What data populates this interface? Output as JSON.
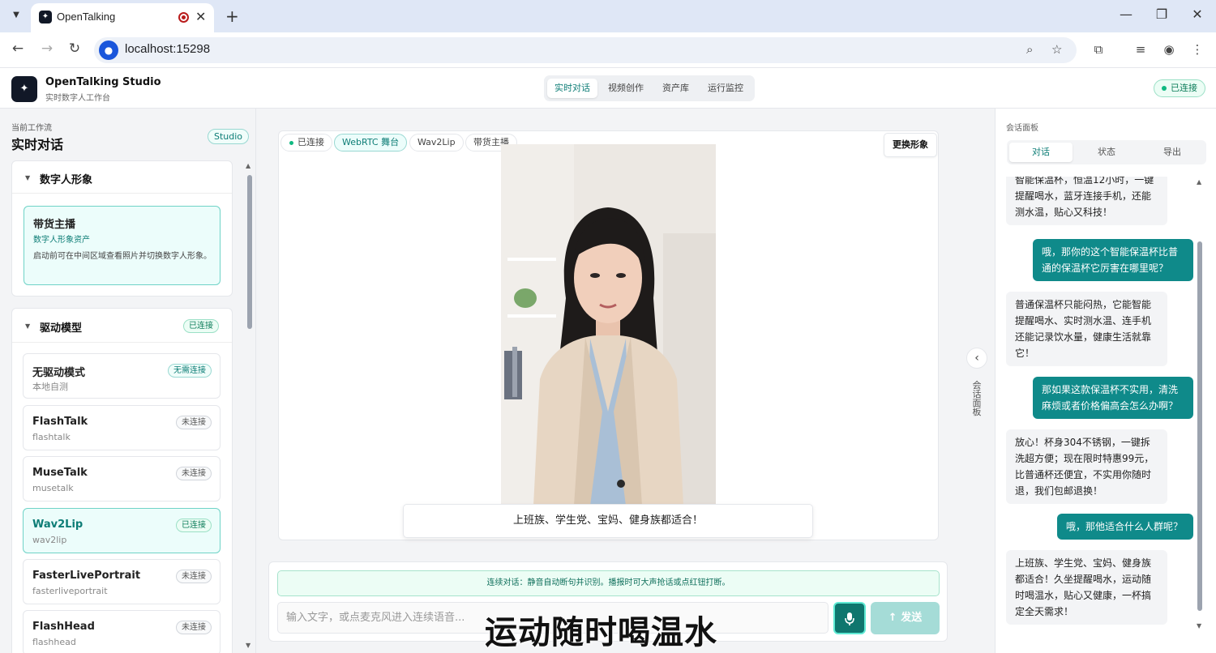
{
  "browser": {
    "tab_title": "OpenTalking",
    "url": "localhost:15298"
  },
  "app": {
    "brand": "OpenTalking Studio",
    "subtitle": "实时数字人工作台",
    "nav": [
      "实时对话",
      "视频创作",
      "资产库",
      "运行监控"
    ],
    "active_nav": "实时对话",
    "status": "已连接"
  },
  "left": {
    "workflow_label": "当前工作流",
    "workflow_title": "实时对话",
    "studio_badge": "Studio",
    "avatar_section": {
      "title": "数字人形象",
      "card_title": "带货主播",
      "card_subtitle": "数字人形象资产",
      "card_desc": "启动前可在中间区域查看照片并切换数字人形象。"
    },
    "driver_section": {
      "title": "驱动模型",
      "badge": "已连接",
      "models": [
        {
          "name": "无驱动模式",
          "id": "本地自测",
          "badge": "无需连接",
          "kind": "none"
        },
        {
          "name": "FlashTalk",
          "id": "flashtalk",
          "badge": "未连接",
          "kind": "off"
        },
        {
          "name": "MuseTalk",
          "id": "musetalk",
          "badge": "未连接",
          "kind": "off"
        },
        {
          "name": "Wav2Lip",
          "id": "wav2lip",
          "badge": "已连接",
          "kind": "ok",
          "selected": true
        },
        {
          "name": "FasterLivePortrait",
          "id": "fasterliveportrait",
          "badge": "未连接",
          "kind": "off"
        },
        {
          "name": "FlashHead",
          "id": "flashhead",
          "badge": "未连接",
          "kind": "off"
        }
      ]
    }
  },
  "stage": {
    "tags": [
      "已连接",
      "WebRTC 舞台",
      "Wav2Lip",
      "带货主播"
    ],
    "swap_button": "更换形象",
    "subtitle": "上班族、学生党、宝妈、健身族都适合！"
  },
  "composer": {
    "hint": "连续对话：静音自动断句并识别。播报时可大声抢话或点红钮打断。",
    "placeholder": "输入文字，或点麦克风进入连续语音...",
    "send_label": "发送"
  },
  "overlay_caption": "运动随时喝温水",
  "collapse_label": "会话面板",
  "right": {
    "label": "会话面板",
    "tabs": [
      "对话",
      "状态",
      "导出"
    ],
    "active_tab": "对话",
    "messages": [
      {
        "role": "ai",
        "text": "智能保温杯，恒温12小时，一键提醒喝水，蓝牙连接手机，还能测水温，贴心又科技！"
      },
      {
        "role": "me",
        "text": "哦，那你的这个智能保温杯比普通的保温杯它厉害在哪里呢？"
      },
      {
        "role": "ai",
        "text": "普通保温杯只能闷热，它能智能提醒喝水、实时测水温、连手机还能记录饮水量，健康生活就靠它！"
      },
      {
        "role": "me",
        "text": "那如果这款保温杯不实用，清洗麻烦或者价格偏高会怎么办啊？"
      },
      {
        "role": "ai",
        "text": "放心！杯身304不锈钢，一键拆洗超方便；现在限时特惠99元，比普通杯还便宜，不实用你随时退，我们包邮退换！"
      },
      {
        "role": "me",
        "text": "哦，那他适合什么人群呢？"
      },
      {
        "role": "ai",
        "text": "上班族、学生党、宝妈、健身族都适合！久坐提醒喝水，运动随时喝温水，贴心又健康，一杯搞定全天需求！"
      }
    ]
  },
  "colors": {
    "accent": "#0f8a8a",
    "success": "#10b981"
  }
}
